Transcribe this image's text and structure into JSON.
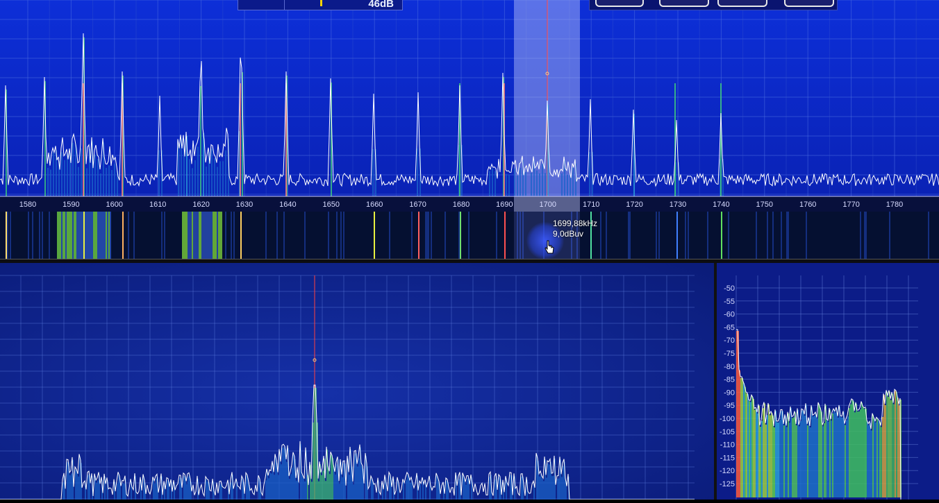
{
  "gain": {
    "value": "46dB"
  },
  "spectrum": {
    "freq_ticks": [
      "1580",
      "1590",
      "1600",
      "1610",
      "1620",
      "1630",
      "1640",
      "1650",
      "1660",
      "1670",
      "1680",
      "1690",
      "1700",
      "1710",
      "1720",
      "1730",
      "1740",
      "1750",
      "1760",
      "1770",
      "1780"
    ]
  },
  "tooltip": {
    "freq": "1699,88kHz",
    "level": "9,0dBuv"
  },
  "side_panel": {
    "db_ticks": [
      "-50",
      "-55",
      "-60",
      "-65",
      "-70",
      "-75",
      "-80",
      "-85",
      "-90",
      "-95",
      "-100",
      "-105",
      "-110",
      "-115",
      "-120",
      "-125"
    ]
  },
  "colors": {
    "accent_red": "#ff3b3b",
    "trace": "#ffffff",
    "grid": "#3f5fd0"
  }
}
